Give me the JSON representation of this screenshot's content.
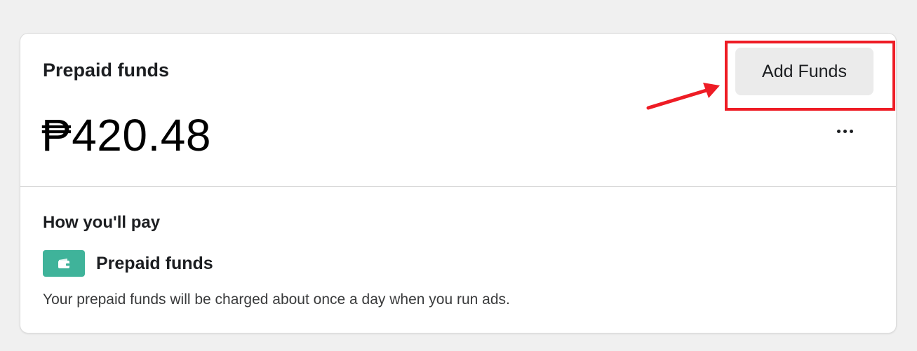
{
  "prepaid": {
    "title": "Prepaid funds",
    "balance": "₱420.48",
    "add_funds_label": "Add Funds",
    "more_label": "···"
  },
  "payment": {
    "title": "How you'll pay",
    "method_label": "Prepaid funds",
    "method_icon": "wallet-icon",
    "note": "Your prepaid funds will be charged about once a day when you run ads."
  },
  "annotation": {
    "highlight_color": "#ee1c25",
    "target": "Add Funds"
  },
  "colors": {
    "badge": "#3fb39a",
    "button_bg": "#ebebeb",
    "page_bg": "#f0f0f0"
  }
}
